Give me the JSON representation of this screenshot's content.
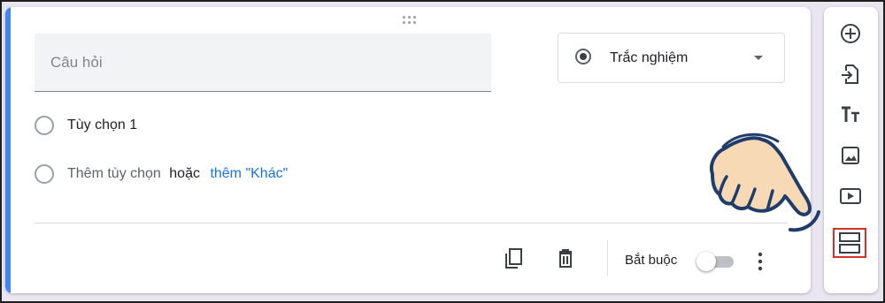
{
  "question": {
    "placeholder": "Câu hỏi",
    "type_selected": "Trắc nghiệm"
  },
  "options": [
    {
      "label": "Tùy chọn 1"
    }
  ],
  "add_option": {
    "add_label": "Thêm tùy chọn",
    "or_label": "hoặc",
    "add_other_label": "thêm \"Khác\""
  },
  "footer": {
    "required_label": "Bắt buộc",
    "required_on": false
  },
  "sidebar": {
    "items": [
      {
        "icon": "add-circle-icon"
      },
      {
        "icon": "import-question-icon"
      },
      {
        "icon": "title-text-icon"
      },
      {
        "icon": "image-icon"
      },
      {
        "icon": "video-icon"
      },
      {
        "icon": "add-section-icon",
        "highlighted": true
      }
    ]
  },
  "colors": {
    "accent": "#4285f4",
    "highlight_border": "#d93025",
    "link": "#1a73e8",
    "hand_fill": "#f8d9b6",
    "hand_outline": "#1f3c6b"
  }
}
